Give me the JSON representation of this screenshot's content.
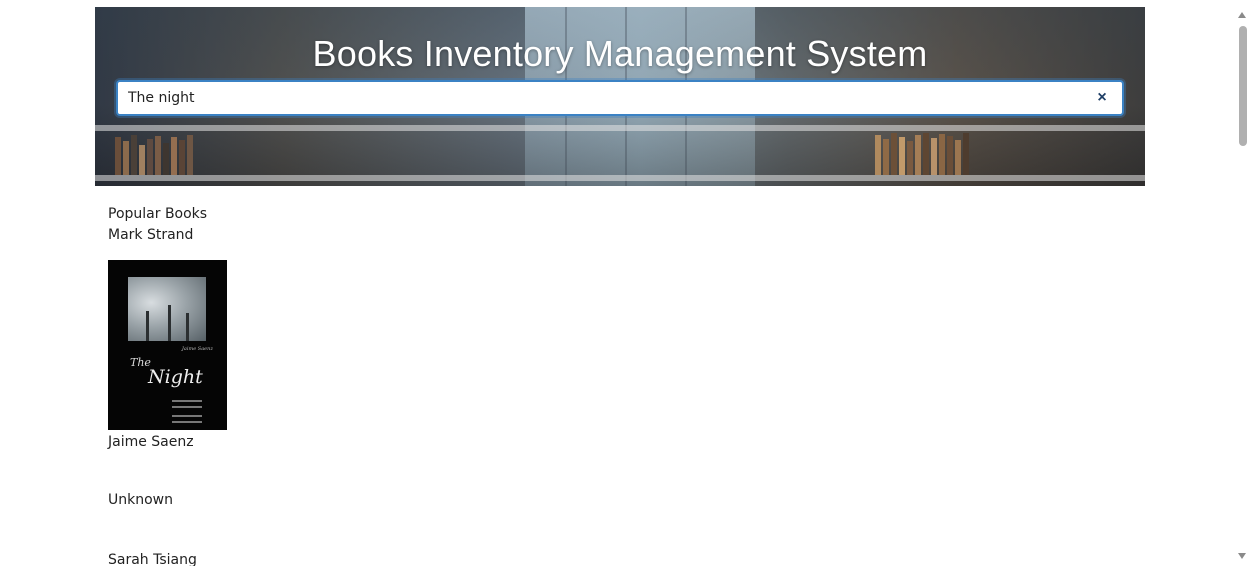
{
  "header": {
    "title": "Books Inventory Management System"
  },
  "search": {
    "value": "The night",
    "clear_icon": "×"
  },
  "main": {
    "section_label": "Popular Books",
    "results": [
      {
        "author": "Mark Strand"
      },
      {
        "author": "Jaime Saenz",
        "cover": {
          "author": "Jaime Saenz",
          "title_line1": "The",
          "title_line2": "Night"
        }
      },
      {
        "author": "Unknown"
      },
      {
        "author": "Sarah Tsiang"
      }
    ]
  },
  "icons": {
    "clear": "close-icon",
    "scroll_up": "chevron-up-icon",
    "scroll_down": "chevron-down-icon"
  }
}
